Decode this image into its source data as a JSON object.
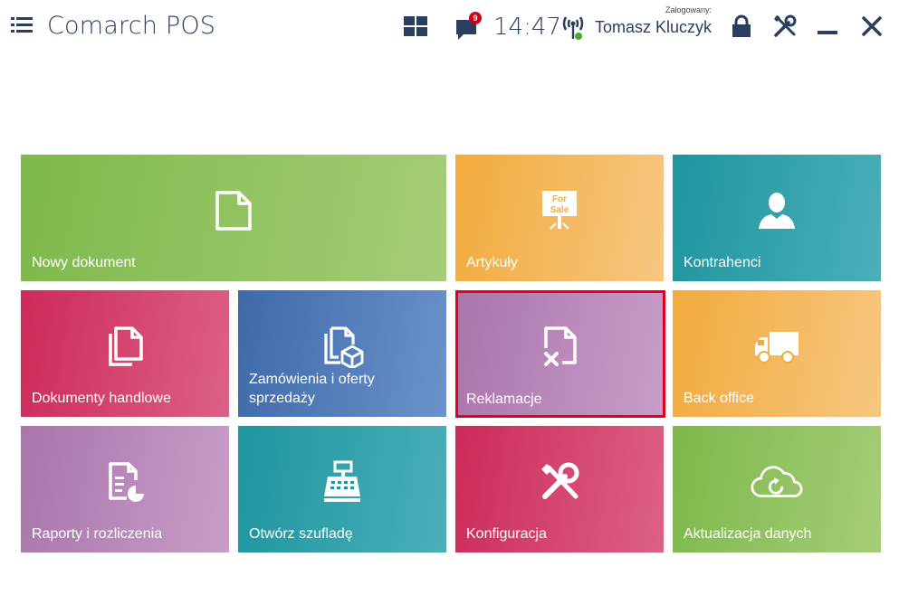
{
  "header": {
    "app_title": "Comarch POS",
    "notification_count": "9",
    "time": "14:47",
    "login_label": "Zalogowany:",
    "user_name": "Tomasz Kluczyk"
  },
  "tiles": [
    {
      "label": "Nowy dokument",
      "icon": "document-icon",
      "color": "#8cc152"
    },
    {
      "label": "Artykuły",
      "icon": "for-sale-sign-icon",
      "color": "#f5b449"
    },
    {
      "label": "Kontrahenci",
      "icon": "person-icon",
      "color": "#23a3ad"
    },
    {
      "label": "Dokumenty handlowe",
      "icon": "documents-icon",
      "color": "#d63b6b"
    },
    {
      "label": "Zamówienia i oferty sprzedaży",
      "icon": "documents-box-icon",
      "color": "#4f7ebe"
    },
    {
      "label": "Reklamacje",
      "icon": "document-x-icon",
      "color": "#b47fb0"
    },
    {
      "label": "Back office",
      "icon": "truck-icon",
      "color": "#f5b449"
    },
    {
      "label": "Raporty i rozliczenia",
      "icon": "report-icon",
      "color": "#b47fb0"
    },
    {
      "label": "Otwórz szufladę",
      "icon": "cash-register-icon",
      "color": "#23a3ad"
    },
    {
      "label": "Konfiguracja",
      "icon": "tools-icon",
      "color": "#d63b6b"
    },
    {
      "label": "Aktualizacja danych",
      "icon": "cloud-sync-icon",
      "color": "#8cc152"
    }
  ]
}
